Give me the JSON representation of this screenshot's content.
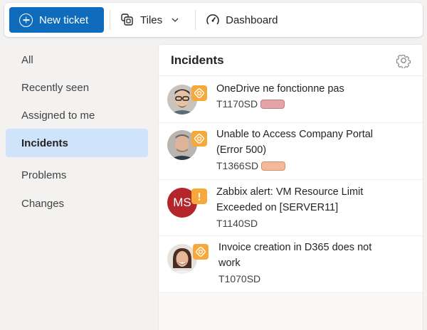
{
  "toolbar": {
    "new_ticket_label": "New ticket",
    "view_label": "Tiles",
    "dashboard_label": "Dashboard",
    "accent": "#0f6cbd"
  },
  "sidebar": {
    "items": [
      {
        "label": "All",
        "active": false
      },
      {
        "label": "Recently seen",
        "active": false
      },
      {
        "label": "Assigned to me",
        "active": false
      },
      {
        "label": "Incidents",
        "active": true
      },
      {
        "label": "Problems",
        "active": false
      },
      {
        "label": "Changes",
        "active": false
      }
    ],
    "active_bg": "#cfe4fa"
  },
  "panel": {
    "title": "Incidents",
    "settings_icon": "gear-icon",
    "tickets": [
      {
        "title_lines": [
          "OneDrive ne fonctionne pas"
        ],
        "id": "T1170SD",
        "priority_color": "#e3a5a8",
        "avatar": "photo",
        "type_icon": "incident-icon"
      },
      {
        "title_lines": [
          "Unable to Access Company Portal",
          "(Error 500)"
        ],
        "id": "T1366SD",
        "priority_color": "#f4b99a",
        "avatar": "photo",
        "type_icon": "incident-icon"
      },
      {
        "title_lines": [
          "Zabbix alert: VM Resource Limit",
          "Exceeded on [SERVER11]"
        ],
        "id": "T1140SD",
        "avatar_initials": "MS",
        "avatar_color": "#b4262b",
        "type_icon": "alert-icon"
      },
      {
        "title_lines": [
          "Invoice creation in D365 does not",
          "work"
        ],
        "id": "T1070SD",
        "avatar": "photo",
        "type_icon": "incident-icon"
      }
    ]
  }
}
